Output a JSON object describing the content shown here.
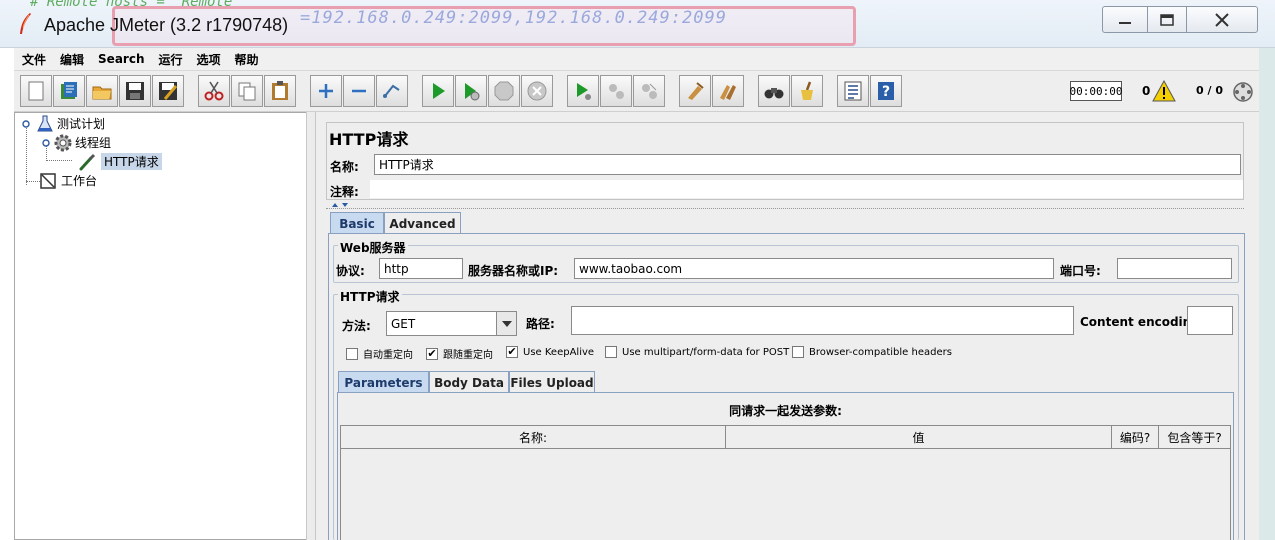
{
  "window": {
    "title": "Apache JMeter (3.2 r1790748)"
  },
  "background_text": {
    "hosts_line": "=192.168.0.249:2099,192.168.0.249:2099",
    "partial_line": "#  Remote hosts = 'Remote'"
  },
  "menu": [
    "文件",
    "编辑",
    "Search",
    "运行",
    "选项",
    "帮助"
  ],
  "toolbar": {
    "timer": "00:00:00",
    "errors": "0",
    "threads": "0 / 0",
    "icons": [
      "new-icon",
      "templates-icon",
      "open-icon",
      "save-icon",
      "save-as-icon",
      "cut-icon",
      "copy-icon",
      "paste-icon",
      "expand-icon",
      "collapse-icon",
      "toggle-icon",
      "start-icon",
      "start-no-pause-icon",
      "stop-icon",
      "shutdown-icon",
      "remote-start-icon",
      "remote-stop-icon",
      "remote-shutdown-icon",
      "clear-icon",
      "clear-all-icon",
      "search-icon",
      "reset-search-icon",
      "function-helper-icon",
      "help-icon"
    ]
  },
  "tree": {
    "root": "测试计划",
    "thread_group": "线程组",
    "http_request": "HTTP请求",
    "workbench": "工作台"
  },
  "panel": {
    "title": "HTTP请求",
    "name_label": "名称:",
    "name_value": "HTTP请求",
    "comment_label": "注释:",
    "comment_value": "",
    "tabs": [
      "Basic",
      "Advanced"
    ],
    "web_server": {
      "legend": "Web服务器",
      "protocol_label": "协议:",
      "protocol_value": "http",
      "server_label": "服务器名称或IP:",
      "server_value": "www.taobao.com",
      "port_label": "端口号:",
      "port_value": ""
    },
    "http_request": {
      "legend": "HTTP请求",
      "method_label": "方法:",
      "method_value": "GET",
      "path_label": "路径:",
      "path_value": "",
      "encoding_label": "Content encoding:",
      "encoding_value": ""
    },
    "checkboxes": [
      {
        "label": "自动重定向",
        "checked": false
      },
      {
        "label": "跟随重定向",
        "checked": true
      },
      {
        "label": "Use KeepAlive",
        "checked": true
      },
      {
        "label": "Use multipart/form-data for POST",
        "checked": false
      },
      {
        "label": "Browser-compatible headers",
        "checked": false
      }
    ],
    "sub_tabs": [
      "Parameters",
      "Body Data",
      "Files Upload"
    ],
    "params_title": "同请求一起发送参数:",
    "columns": [
      "名称:",
      "值",
      "编码?",
      "包含等于?"
    ]
  }
}
